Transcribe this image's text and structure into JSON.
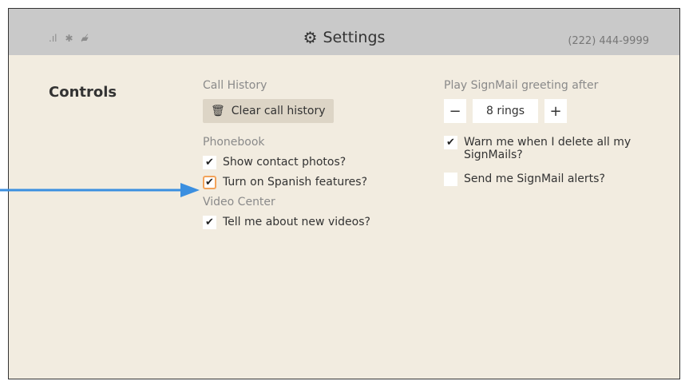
{
  "header": {
    "title": "Settings",
    "phone": "(222) 444-9999",
    "status_icons": [
      "signal-icon",
      "bluetooth-icon",
      "video-off-icon"
    ]
  },
  "section": {
    "label": "Controls"
  },
  "call_history": {
    "title": "Call History",
    "clear_button": "Clear call history"
  },
  "phonebook": {
    "title": "Phonebook",
    "items": [
      {
        "label": "Show contact photos?",
        "checked": true
      },
      {
        "label": "Turn on Spanish features?",
        "checked": true
      }
    ]
  },
  "video_center": {
    "title": "Video Center",
    "items": [
      {
        "label": "Tell me about new videos?",
        "checked": true
      }
    ]
  },
  "signmail": {
    "greeting_title": "Play SignMail greeting after",
    "stepper_minus": "−",
    "stepper_value": "8 rings",
    "stepper_plus": "+",
    "items": [
      {
        "label": "Warn me when I delete all my SignMails?",
        "checked": true
      },
      {
        "label": "Send me SignMail alerts?",
        "checked": false
      }
    ]
  },
  "annotation": {
    "color": "#3b8fe0"
  }
}
